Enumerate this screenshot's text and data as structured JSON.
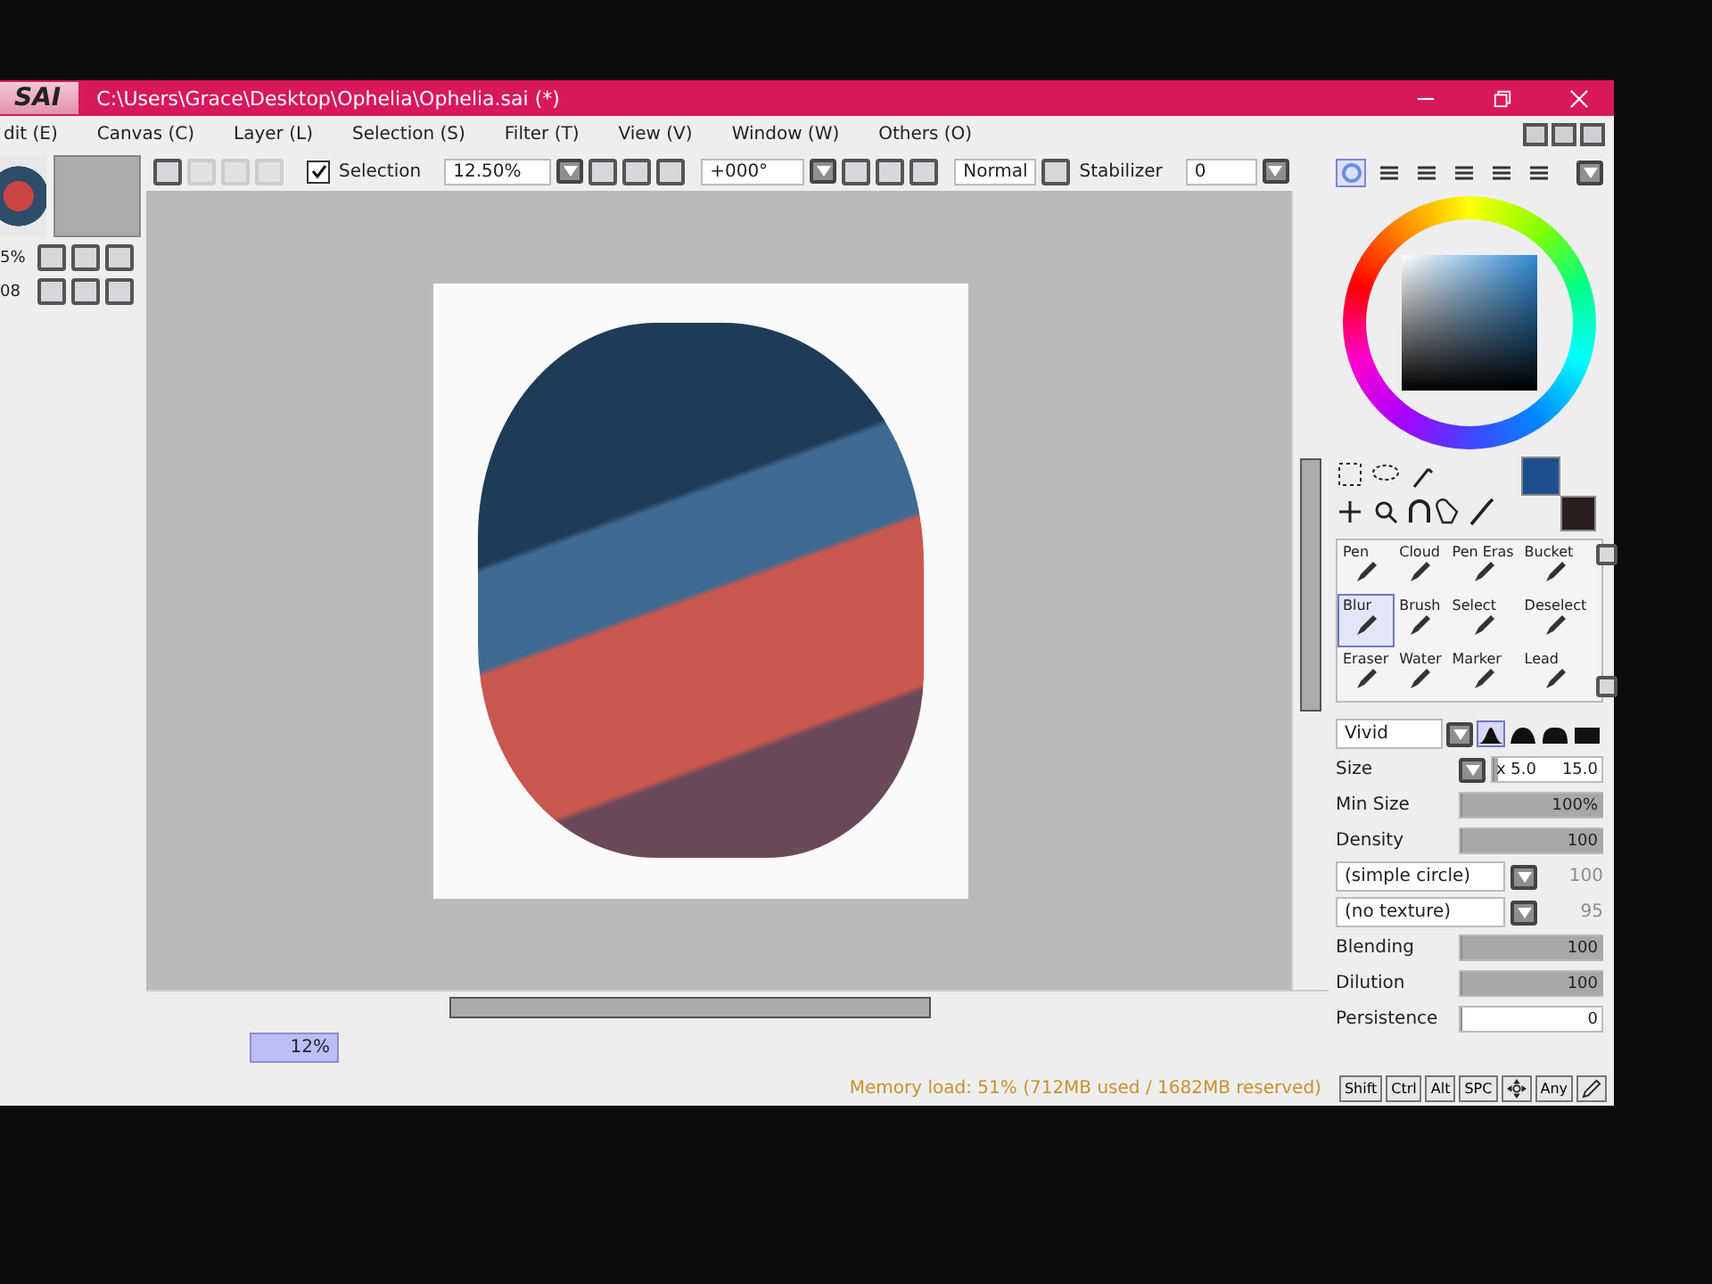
{
  "window": {
    "logo": "SAI",
    "title": "C:\\Users\\Grace\\Desktop\\Ophelia\\Ophelia.sai (*)"
  },
  "menu": [
    "dit (E)",
    "Canvas (C)",
    "Layer (L)",
    "Selection (S)",
    "Filter (T)",
    "View (V)",
    "Window (W)",
    "Others (O)"
  ],
  "navigator": {
    "zoom": "5%",
    "angle": "08"
  },
  "toolbar": {
    "selection": {
      "label": "Selection",
      "checked": true
    },
    "zoom": "12.50%",
    "rotation": "+000°",
    "blend_mode": "Normal",
    "stabilizer": {
      "label": "Stabilizer",
      "value": "0"
    }
  },
  "panel_tabs": [
    {
      "selected": true
    },
    {
      "selected": false
    },
    {
      "selected": false
    },
    {
      "selected": false
    },
    {
      "selected": false
    },
    {
      "selected": false
    }
  ],
  "tools": [
    {
      "label": "Pen",
      "selected": false
    },
    {
      "label": "Cloud",
      "selected": false
    },
    {
      "label": "Pen Eras",
      "selected": false
    },
    {
      "label": "Bucket",
      "selected": false
    },
    {
      "label": "Blur",
      "selected": true
    },
    {
      "label": "Brush",
      "selected": false
    },
    {
      "label": "Select",
      "selected": false
    },
    {
      "label": "Deselect",
      "selected": false
    },
    {
      "label": "Eraser",
      "selected": false
    },
    {
      "label": "Water",
      "selected": false
    },
    {
      "label": "Marker",
      "selected": false
    },
    {
      "label": "Lead",
      "selected": false
    }
  ],
  "brush": {
    "mode": "Vivid",
    "tips": [
      {
        "selected": true
      },
      {
        "selected": false
      },
      {
        "selected": false
      },
      {
        "selected": false
      }
    ]
  },
  "settings": [
    {
      "kind": "slider",
      "label": "Size",
      "multiplier": "x 5.0",
      "value": "15.0",
      "level": 0.03
    },
    {
      "kind": "slider",
      "label": "Min Size",
      "value": "100%",
      "level": 1
    },
    {
      "kind": "slider",
      "label": "Density",
      "value": "100",
      "level": 1
    },
    {
      "kind": "select",
      "label": "(simple circle)",
      "value": "100",
      "disabled": true
    },
    {
      "kind": "select",
      "label": "(no texture)",
      "value": "95",
      "disabled": true
    },
    {
      "kind": "slider",
      "label": "Blending",
      "value": "100",
      "level": 1
    },
    {
      "kind": "slider",
      "label": "Dilution",
      "value": "100",
      "level": 1
    },
    {
      "kind": "slider",
      "label": "Persistence",
      "value": "0",
      "level": 0
    }
  ],
  "status": {
    "progress": "12%",
    "memory": "Memory load: 51% (712MB used / 1682MB reserved)",
    "keys": [
      "Shift",
      "Ctrl",
      "Alt",
      "SPC"
    ],
    "any_key": "Any"
  }
}
